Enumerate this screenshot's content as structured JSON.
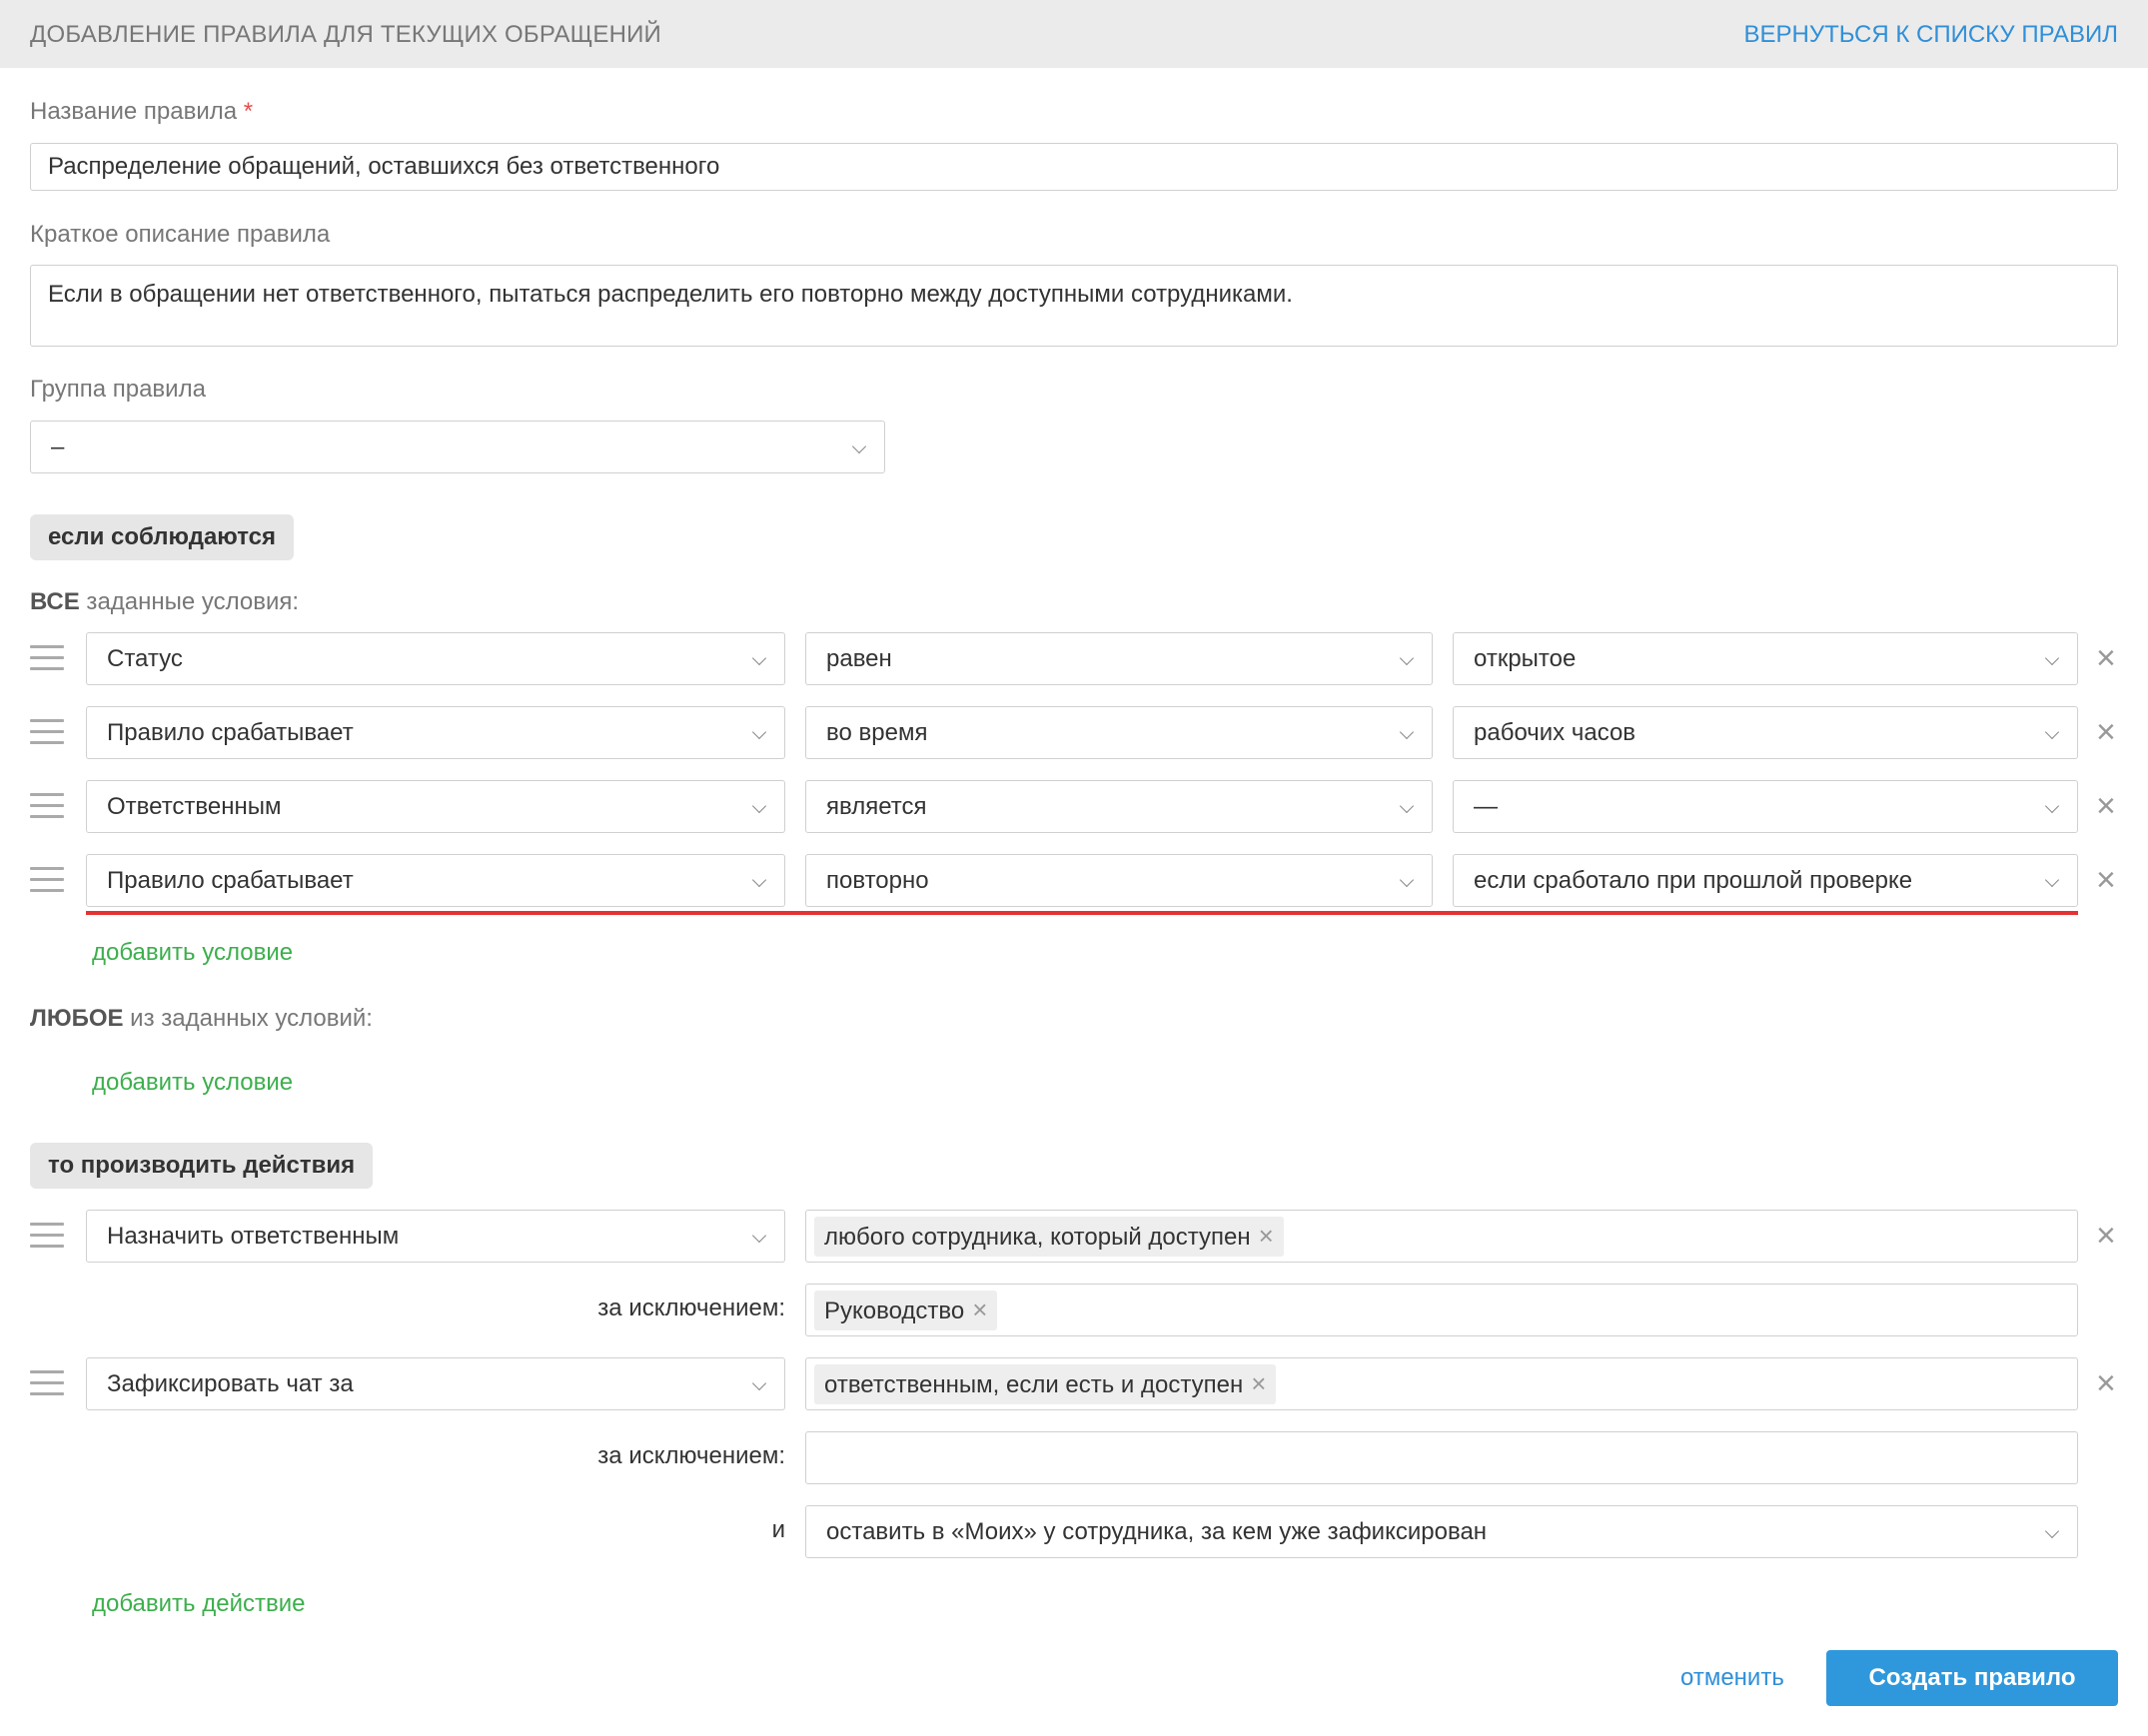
{
  "header": {
    "title": "ДОБАВЛЕНИЕ ПРАВИЛА ДЛЯ ТЕКУЩИХ ОБРАЩЕНИЙ",
    "back_link": "ВЕРНУТЬСЯ К СПИСКУ ПРАВИЛ"
  },
  "form": {
    "name_label": "Название правила",
    "required_mark": "*",
    "name_value": "Распределение обращений, оставшихся без ответственного",
    "desc_label": "Краткое описание правила",
    "desc_value": "Если в обращении нет ответственного, пытаться распределить его повторно между доступными сотрудниками.",
    "group_label": "Группа правила",
    "group_value": "–"
  },
  "conditions": {
    "badge": "если соблюдаются",
    "all_bold": "ВСЕ",
    "all_rest": " заданные условия:",
    "rows": [
      {
        "field": "Статус",
        "op": "равен",
        "value": "открытое"
      },
      {
        "field": "Правило срабатывает",
        "op": "во время",
        "value": "рабочих часов"
      },
      {
        "field": "Ответственным",
        "op": "является",
        "value": "—"
      },
      {
        "field": "Правило срабатывает",
        "op": "повторно",
        "value": "если сработало при прошлой проверке"
      }
    ],
    "add_condition_1": "добавить условие",
    "any_bold": "ЛЮБОЕ",
    "any_rest": " из заданных условий:",
    "add_condition_2": "добавить условие"
  },
  "actions": {
    "badge": "то производить действия",
    "assign": {
      "action": "Назначить ответственным",
      "tag": "любого сотрудника, который доступен",
      "except_label": "за исключением:",
      "except_tag": "Руководство"
    },
    "fix": {
      "action": "Зафиксировать чат за",
      "tag": "ответственным, если есть и доступен",
      "except_label": "за исключением:",
      "and_label": "и",
      "and_value": "оставить в «Моих» у сотрудника, за кем уже зафиксирован"
    },
    "add_action": "добавить действие"
  },
  "footer": {
    "cancel": "отменить",
    "submit": "Создать правило"
  },
  "icons": {
    "remove": "×",
    "tag_remove": "×"
  },
  "colors": {
    "link_blue": "#2f8fd8",
    "add_green": "#3caf4c",
    "primary": "#2f98dc",
    "highlight_red": "#e53333"
  }
}
